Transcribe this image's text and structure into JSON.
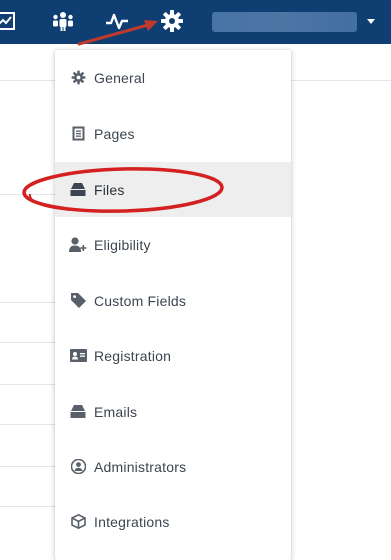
{
  "topbar": {
    "background": "#0f3e72",
    "nav_icons": [
      {
        "name": "activity-chart-icon"
      },
      {
        "name": "team-icon"
      },
      {
        "name": "pulse-icon"
      },
      {
        "name": "gear-icon"
      }
    ],
    "account_selector": {
      "blurred": true,
      "caret": "caret-down-icon"
    }
  },
  "settings_menu": {
    "items": [
      {
        "label": "General",
        "icon": "gear-icon",
        "active": false
      },
      {
        "label": "Pages",
        "icon": "document-icon",
        "active": false
      },
      {
        "label": "Files",
        "icon": "tray-icon",
        "active": true
      },
      {
        "label": "Eligibility",
        "icon": "user-plus-icon",
        "active": false
      },
      {
        "label": "Custom Fields",
        "icon": "tag-icon",
        "active": false
      },
      {
        "label": "Registration",
        "icon": "id-card-icon",
        "active": false
      },
      {
        "label": "Emails",
        "icon": "tray-icon",
        "active": false
      },
      {
        "label": "Administrators",
        "icon": "user-circle-icon",
        "active": false
      },
      {
        "label": "Integrations",
        "icon": "cube-icon",
        "active": false
      }
    ],
    "active_background": "#eeeeee"
  },
  "annotations": {
    "arrow_color": "#c0392b",
    "highlight_ellipse_color": "#d42020"
  }
}
